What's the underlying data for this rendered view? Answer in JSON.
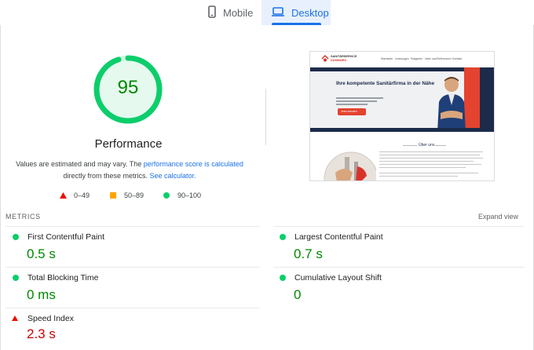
{
  "tabs": {
    "mobile_label": "Mobile",
    "desktop_label": "Desktop",
    "active": "Desktop"
  },
  "score": {
    "value": "95",
    "fraction": 0.95,
    "category": "Performance",
    "color": "#0cce6b"
  },
  "disclaimer": {
    "part1": "Values are estimated and may vary. The ",
    "link1": "performance score is calculated",
    "part2": " directly from these metrics. ",
    "link2": "See calculator."
  },
  "legend": {
    "fail": "0–49",
    "average": "50–89",
    "pass": "90–100"
  },
  "screenshot": {
    "logo_line1": "SANITÄRSERVICE",
    "logo_line2": "DUISBURG",
    "nav": [
      "Startseite",
      "Leistungen",
      "Ratgeber",
      "Über uns",
      "Referenzen",
      "Kontakt"
    ],
    "headline": "Ihre kompetente Sanitärfirma in der Nähe",
    "cta": "Jetzt anrufen",
    "section_title": "Über uns"
  },
  "metrics": {
    "header": "METRICS",
    "expand_label": "Expand view",
    "fcp": {
      "name": "First Contentful Paint",
      "value": "0.5 s",
      "status": "pass"
    },
    "lcp": {
      "name": "Largest Contentful Paint",
      "value": "0.7 s",
      "status": "pass"
    },
    "tbt": {
      "name": "Total Blocking Time",
      "value": "0 ms",
      "status": "pass"
    },
    "cls": {
      "name": "Cumulative Layout Shift",
      "value": "0",
      "status": "pass"
    },
    "si": {
      "name": "Speed Index",
      "value": "2.3 s",
      "status": "fail"
    }
  }
}
